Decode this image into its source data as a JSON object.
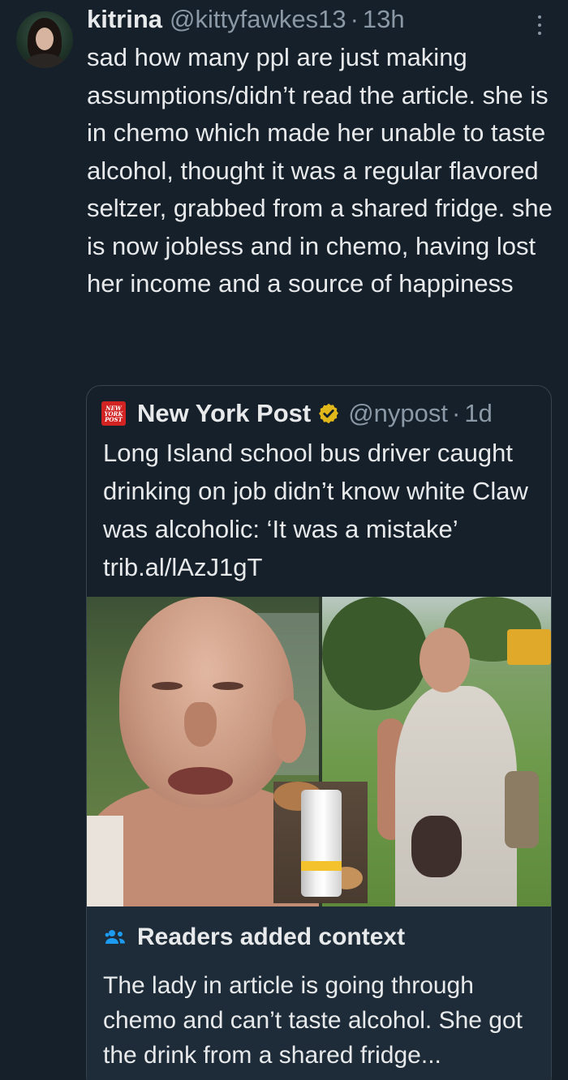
{
  "tweet": {
    "author_name": "kitrina",
    "author_handle": "@kittyfawkes13",
    "separator": "·",
    "time": "13h",
    "text": "sad how many ppl are just making assumptions/didn’t read the article. she is in chemo which made her unable to taste alcohol, thought it was a regular flavored seltzer, grabbed from a shared fridge. she is now jobless and in chemo, having lost her income and a source of happiness",
    "more_icon": "more-vertical-icon"
  },
  "quoted_tweet": {
    "logo_lines": [
      "NEW",
      "YORK",
      "POST"
    ],
    "author_name": "New York Post",
    "verified_icon": "gold-checkmark-badge-icon",
    "author_handle": "@nypost",
    "separator": "·",
    "time": "1d",
    "text": "Long Island school bus driver caught drinking on job didn’t know white Claw was alcoholic: ‘It was a mistake’ trib.al/lAzJ1gT",
    "media_description_icon": "photo-collage"
  },
  "community_note": {
    "icon": "people-icon",
    "title": "Readers added context",
    "text": "The lady in article is going through chemo and can’t taste alcohol. She got the drink from a shared fridge..."
  },
  "colors": {
    "background": "#15202b",
    "text_primary": "#e7e9ea",
    "text_secondary": "#8b98a5",
    "border": "#38444d",
    "note_background": "#1e2c39",
    "accent_blue": "#1d9bf0",
    "verified_gold": "#e2b719",
    "nyp_red": "#d22323"
  }
}
